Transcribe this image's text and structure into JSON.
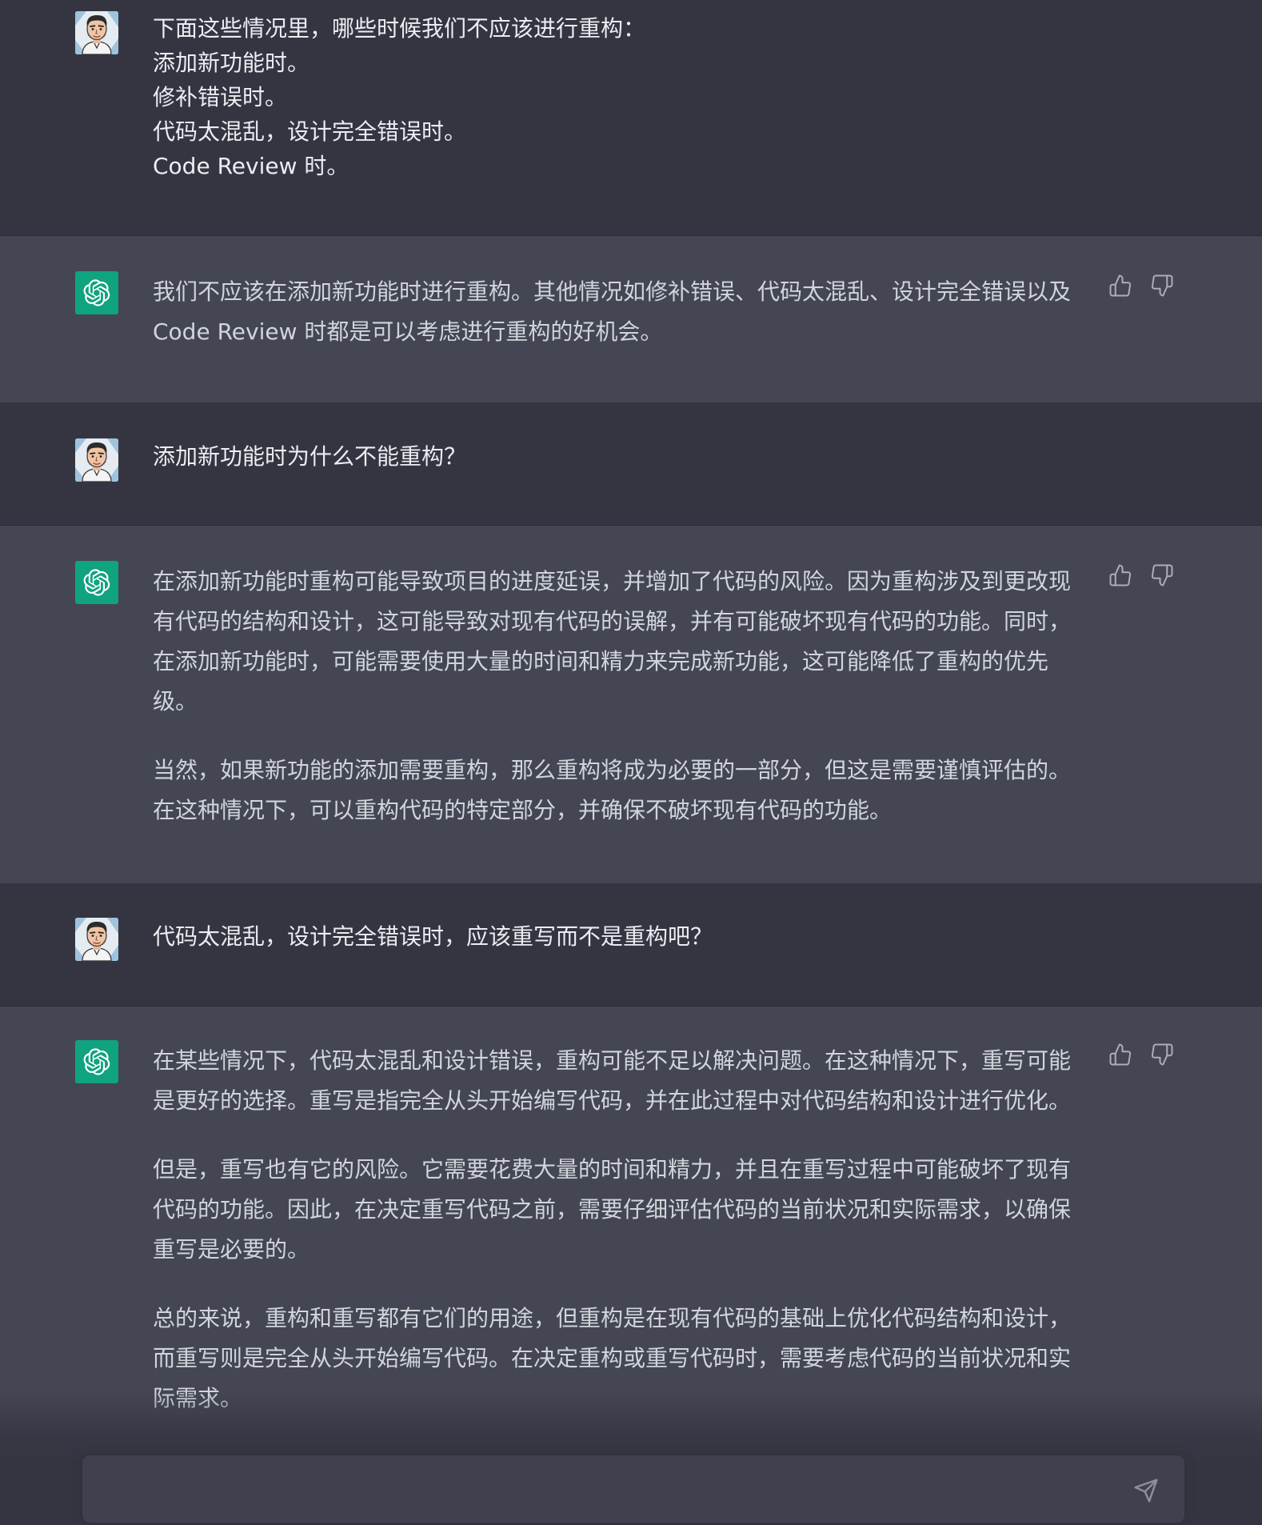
{
  "conversation": {
    "m1": {
      "role": "user",
      "lines": [
        "下面这些情况里，哪些时候我们不应该进行重构：",
        "添加新功能时。",
        "修补错误时。",
        "代码太混乱，设计完全错误时。",
        "Code Review 时。"
      ]
    },
    "m2": {
      "role": "assistant",
      "paragraphs": [
        "我们不应该在添加新功能时进行重构。其他情况如修补错误、代码太混乱、设计完全错误以及 Code Review 时都是可以考虑进行重构的好机会。"
      ]
    },
    "m3": {
      "role": "user",
      "lines": [
        "添加新功能时为什么不能重构？"
      ]
    },
    "m4": {
      "role": "assistant",
      "paragraphs": [
        "在添加新功能时重构可能导致项目的进度延误，并增加了代码的风险。因为重构涉及到更改现有代码的结构和设计，这可能导致对现有代码的误解，并有可能破坏现有代码的功能。同时，在添加新功能时，可能需要使用大量的时间和精力来完成新功能，这可能降低了重构的优先级。",
        "当然，如果新功能的添加需要重构，那么重构将成为必要的一部分，但这是需要谨慎评估的。在这种情况下，可以重构代码的特定部分，并确保不破坏现有代码的功能。"
      ]
    },
    "m5": {
      "role": "user",
      "lines": [
        "代码太混乱，设计完全错误时，应该重写而不是重构吧？"
      ]
    },
    "m6": {
      "role": "assistant",
      "paragraphs": [
        "在某些情况下，代码太混乱和设计错误，重构可能不足以解决问题。在这种情况下，重写可能是更好的选择。重写是指完全从头开始编写代码，并在此过程中对代码结构和设计进行优化。",
        "但是，重写也有它的风险。它需要花费大量的时间和精力，并且在重写过程中可能破坏了现有代码的功能。因此，在决定重写代码之前，需要仔细评估代码的当前状况和实际需求，以确保重写是必要的。",
        "总的来说，重构和重写都有它们的用途，但重构是在现有代码的基础上优化代码结构和设计，而重写则是完全从头开始编写代码。在决定重构或重写代码时，需要考虑代码的当前状况和实际需求。"
      ]
    }
  },
  "icons": {
    "avatar_user": "user-avatar",
    "avatar_assistant": "openai-logo-icon",
    "like": "thumbs-up-icon",
    "dislike": "thumbs-down-icon",
    "send": "paper-plane-icon"
  },
  "composer": {
    "placeholder": ""
  },
  "colors": {
    "user_bg": "#343541",
    "assistant_bg": "#444654",
    "gpt_brand": "#10a37f",
    "text": "#ececf1"
  }
}
